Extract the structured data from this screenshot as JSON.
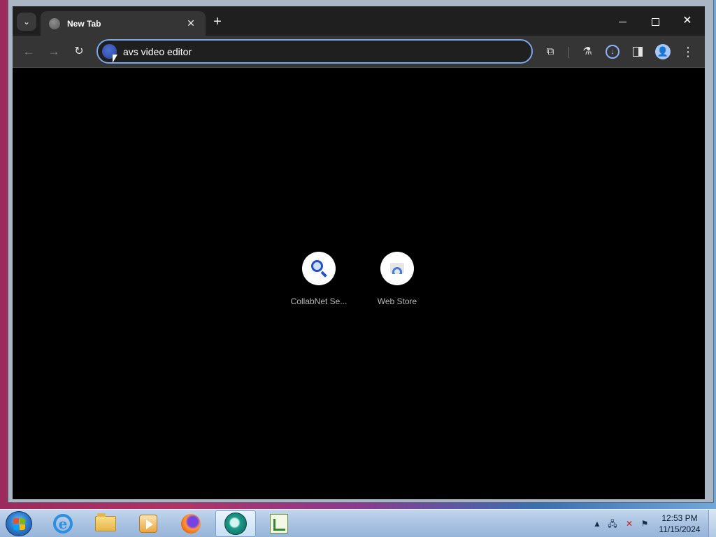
{
  "browser": {
    "tab": {
      "title": "New Tab",
      "close_glyph": "✕",
      "favicon": "globe-icon"
    },
    "new_tab_glyph": "+",
    "tab_search_glyph": "⌄",
    "window_controls": {
      "minimize": "minimize-icon",
      "maximize": "maximize-icon",
      "close": "✕"
    },
    "toolbar": {
      "back_glyph": "←",
      "forward_glyph": "→",
      "reload_glyph": "↻",
      "address_value": "avs video editor",
      "extensions_glyph": "⧉",
      "labs_glyph": "⚗",
      "download_glyph": "↓",
      "profile_glyph": "👤",
      "menu_glyph": "⋮"
    },
    "accent_color": "#7ca7e8"
  },
  "newtab": {
    "shortcuts": [
      {
        "label": "CollabNet Se...",
        "icon": "magnifier-icon"
      },
      {
        "label": "Web Store",
        "icon": "web-store-icon"
      }
    ]
  },
  "taskbar": {
    "apps": [
      {
        "name": "internet-explorer",
        "glyph": "e"
      },
      {
        "name": "file-explorer"
      },
      {
        "name": "media-player"
      },
      {
        "name": "firefox"
      },
      {
        "name": "avs-video-editor",
        "active": true
      },
      {
        "name": "editor-app"
      }
    ],
    "tray": {
      "up_glyph": "▲",
      "network_glyph": "🖧",
      "volume_glyph": "✕",
      "flag_glyph": "⚑"
    },
    "clock": {
      "time": "12:53 PM",
      "date": "11/15/2024"
    }
  }
}
